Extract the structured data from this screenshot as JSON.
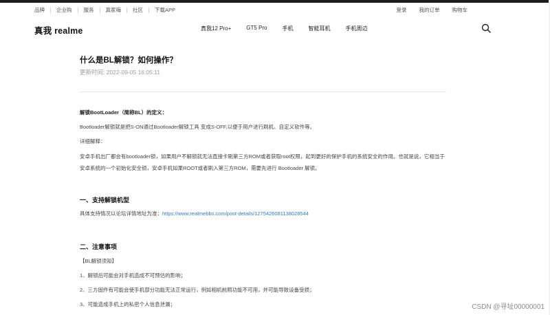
{
  "utility_bar": {
    "left_links": [
      "品牌",
      "企业购",
      "服务",
      "真家嗨",
      "社区",
      "下载APP"
    ],
    "right_links": [
      "登录",
      "我的订单",
      "购物车"
    ]
  },
  "nav": {
    "logo": "真我 realme",
    "menu": [
      "真我12 Pro+",
      "GT5 Pro",
      "手机",
      "智能耳机",
      "手机周边"
    ],
    "search_icon": "search-icon"
  },
  "article": {
    "title": "什么是BL解锁？如何操作？",
    "updated": "更新时间: 2022-09-05 16:05:11",
    "definition_heading": "解锁BootLoader（简称BL）的定义：",
    "definition_text": "Bootloader解锁就是把S-ON通过Bootloader解锁工具 变成S-OFF,以便于用户进行刷机、自定义软件等。",
    "detail_label": "详细解释：",
    "detail_text": "安卓手机出厂都会有bootloader锁，如果用户不解锁就无法直接卡刷第三方ROM或者获取root权限，起到更好的保护手机的系统安全的作用。也就是说，它相当于安卓系统的一个初始化安全锁，安卓手机如果ROOT或者刷入第三方ROM，需要先进行 Bootloader 解锁。",
    "section1_heading": "一、支持解锁机型",
    "section1_text": "具体支持情况以论坛详情地址为准：",
    "section1_link": "https://www.realmebbs.com/post-details/1275426081138028544",
    "section2_heading": "二、注意事项",
    "notice_label": "【BL解锁须知】",
    "notices": [
      "1、解锁后可能会对手机造成不可预估的影响；",
      "2、三方固件有可能会使手机部分功能无法正常运行，例如相机前照功能不可用，并可能导致设备受损；",
      "3、可能造成手机上的私密个人信息泄漏；"
    ]
  },
  "watermark": "CSDN @寻址00000001",
  "colors": {
    "link": "#2d7ad6",
    "top_strip": "#1c1c1c"
  }
}
